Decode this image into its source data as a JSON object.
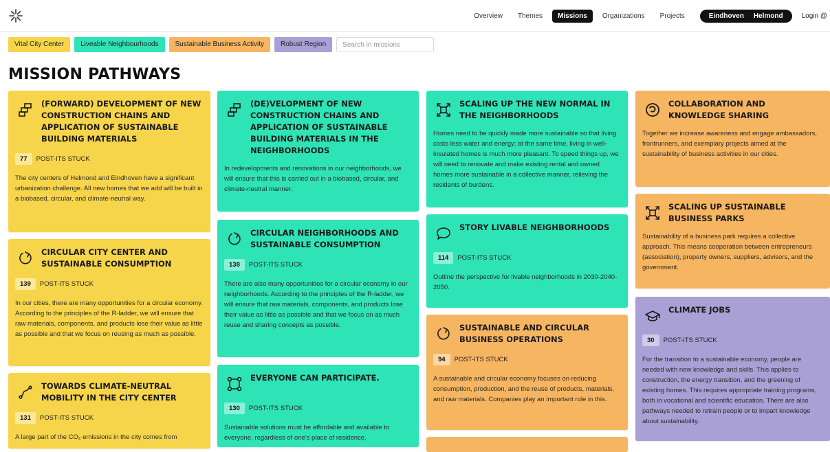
{
  "nav": {
    "items": [
      "Overview",
      "Themes",
      "Missions",
      "Organizations",
      "Projects"
    ],
    "cities": [
      "Eindhoven",
      "Helmond"
    ],
    "login": "Login"
  },
  "filters": {
    "chips": [
      {
        "label": "Vital City Center",
        "color": "#f6d54a"
      },
      {
        "label": "Liveable Neighbourhoods",
        "color": "#2ee3b6"
      },
      {
        "label": "Sustainable Business Activity",
        "color": "#f6b560"
      },
      {
        "label": "Robust Region",
        "color": "#a9a0d6"
      }
    ],
    "search_placeholder": "Search in missions"
  },
  "page_title": "MISSION PATHWAYS",
  "stuck_label": "POST-ITS STUCK",
  "colors": {
    "yellow": "#f6d54a",
    "teal": "#2ee3b6",
    "orange": "#f6b560",
    "purple": "#a9a0d6"
  },
  "cards": [
    {
      "title": "(Forward) development of new construction chains and application of sustainable building materials",
      "count": "77",
      "desc": "The city centers of Helmond and Eindhoven have a significant urbanization challenge. All new homes that we add will be built in a biobased, circular, and climate-neutral way.",
      "icon": "blocks-icon"
    },
    {
      "title": "Circular city center and sustainable consumption",
      "count": "139",
      "desc": "In our cities, there are many opportunities for a circular economy. According to the principles of the R-ladder, we will ensure that raw materials, components, and products lose their value as little as possible and that we focus on reusing as much as possible.",
      "icon": "circular-arrow-icon"
    },
    {
      "title": "Towards climate-neutral mobility in the city center",
      "count": "131",
      "desc": "A large part of the CO₂ emissions in the city comes from",
      "icon": "route-icon"
    },
    {
      "title": "(De)velopment of new construction chains and application of sustainable building materials in the neighborhoods",
      "desc": "In redevelopments and renovations in our neighborhoods, we will ensure that this is carried out in a biobased, circular, and climate-neutral manner.",
      "icon": "blocks-icon"
    },
    {
      "title": "Circular neighborhoods and sustainable consumption",
      "count": "138",
      "desc": "There are also many opportunities for a circular economy in our neighborhoods. According to the principles of the R-ladder, we will ensure that raw materials, components, and products lose their value as little as possible and that we focus on as much reuse and sharing concepts as possible.",
      "icon": "circular-arrow-icon"
    },
    {
      "title": "Everyone can participate.",
      "count": "130",
      "desc": "Sustainable solutions must be affordable and available to everyone, regardless of one's place of residence,",
      "icon": "group-icon"
    },
    {
      "title": "Scaling up the new normal in the neighborhoods",
      "desc": "Homes need to be quickly made more sustainable so that living costs less water and energy; at the same time, living in well-insulated homes is much more pleasant. To speed things up, we will need to renovate and make existing rental and owned homes more sustainable in a collective manner, relieving the residents of burdens.",
      "icon": "scale-up-icon"
    },
    {
      "title": "Story livable neighborhoods",
      "count": "114",
      "desc": "Outline the perspective for livable neighborhoods in 2030-2040-2050.",
      "icon": "speech-bubble-icon"
    },
    {
      "title": "Sustainable and circular business operations",
      "count": "94",
      "desc": "A sustainable and circular economy focuses on reducing consumption, production, and the reuse of products, materials, and raw materials. Companies play an important role in this.",
      "icon": "circular-arrow-icon"
    },
    {
      "title": "Collaboration and knowledge sharing",
      "desc": "Together we increase awareness and engage ambassadors, frontrunners, and exemplary projects aimed at the sustainability of business activities in our cities.",
      "icon": "collaboration-icon"
    },
    {
      "title": "Scaling up sustainable business parks",
      "desc": "Sustainability of a business park requires a collective approach. This means cooperation between entrepreneurs (association), property owners, suppliers, advisors, and the government.",
      "icon": "scale-up-icon"
    },
    {
      "title": "Climate jobs",
      "count": "30",
      "desc": "For the transition to a sustainable economy, people are needed with new knowledge and skills. This applies to construction, the energy transition, and the greening of existing homes. This requires appropriate training programs, both in vocational and scientific education. There are also pathways needed to retrain people or to impart knowledge about sustainability.",
      "icon": "graduation-cap-icon"
    }
  ]
}
